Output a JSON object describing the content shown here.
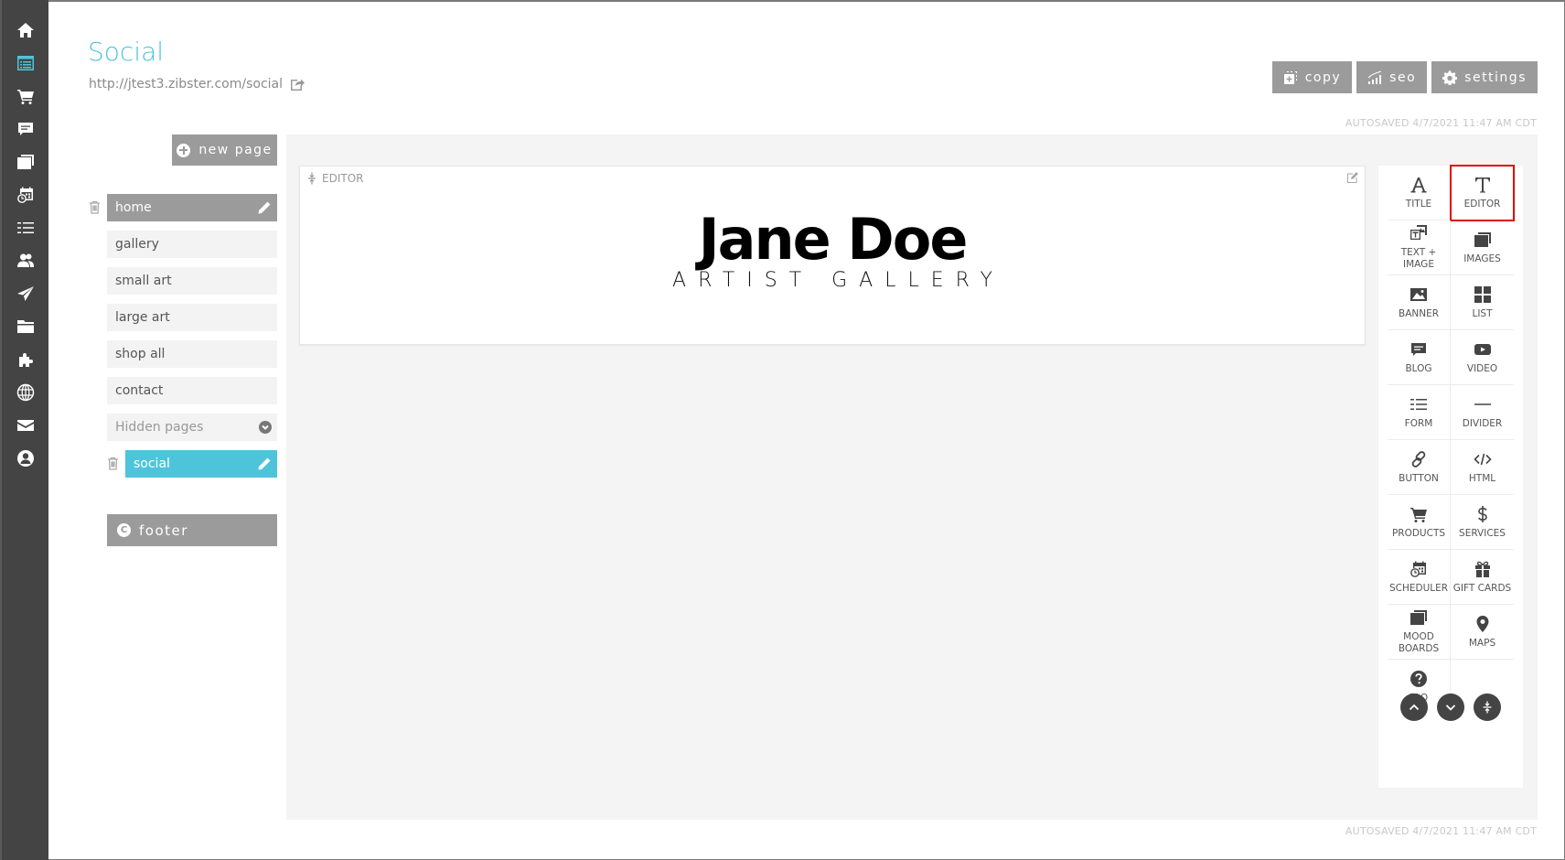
{
  "header": {
    "title": "Social",
    "url": "http://jtest3.zibster.com/social",
    "buttons": [
      {
        "label": "copy",
        "icon": "copy-icon"
      },
      {
        "label": "seo",
        "icon": "signal-bars-icon"
      },
      {
        "label": "settings",
        "icon": "gear-icon"
      }
    ],
    "autosaved_top": "AUTOSAVED 4/7/2021 11:47 AM CDT",
    "autosaved_bottom": "AUTOSAVED 4/7/2021 11:47 AM CDT"
  },
  "sidebar": {
    "items": [
      {
        "name": "home",
        "icon": "home-icon"
      },
      {
        "name": "pages",
        "icon": "pages-icon",
        "active": true
      },
      {
        "name": "store",
        "icon": "cart-icon"
      },
      {
        "name": "blog",
        "icon": "chat-icon"
      },
      {
        "name": "gallery",
        "icon": "images-icon"
      },
      {
        "name": "scheduler",
        "icon": "calendar-clock-icon"
      },
      {
        "name": "forms",
        "icon": "list-icon"
      },
      {
        "name": "contacts",
        "icon": "users-icon"
      },
      {
        "name": "campaigns",
        "icon": "paper-plane-icon"
      },
      {
        "name": "files",
        "icon": "folder-icon"
      },
      {
        "name": "apps",
        "icon": "puzzle-icon"
      },
      {
        "name": "domains",
        "icon": "globe-icon"
      },
      {
        "name": "email",
        "icon": "envelope-icon"
      },
      {
        "name": "account",
        "icon": "user-circle-icon"
      }
    ]
  },
  "pages": {
    "new_page_label": "new page",
    "list": [
      {
        "label": "home",
        "state": "selected"
      },
      {
        "label": "gallery"
      },
      {
        "label": "small art"
      },
      {
        "label": "large art"
      },
      {
        "label": "shop all"
      },
      {
        "label": "contact"
      }
    ],
    "hidden_toggle": "Hidden pages",
    "hidden_list": [
      {
        "label": "social",
        "state": "active"
      }
    ],
    "footer_label": "footer"
  },
  "editor": {
    "block_label": "EDITOR",
    "logo_name": "Jane Doe",
    "logo_subtitle": "ARTIST GALLERY"
  },
  "widgets": {
    "items": [
      {
        "label": "TITLE",
        "icon": "title-a-icon"
      },
      {
        "label": "EDITOR",
        "icon": "text-t-icon",
        "highlighted": true
      },
      {
        "label": "TEXT + IMAGE",
        "icon": "text-image-icon"
      },
      {
        "label": "IMAGES",
        "icon": "images-icon"
      },
      {
        "label": "BANNER",
        "icon": "banner-image-icon"
      },
      {
        "label": "LIST",
        "icon": "grid-icon"
      },
      {
        "label": "BLOG",
        "icon": "chat-icon"
      },
      {
        "label": "VIDEO",
        "icon": "video-play-icon"
      },
      {
        "label": "FORM",
        "icon": "form-list-icon"
      },
      {
        "label": "DIVIDER",
        "icon": "divider-icon"
      },
      {
        "label": "BUTTON",
        "icon": "link-icon"
      },
      {
        "label": "HTML",
        "icon": "code-icon"
      },
      {
        "label": "PRODUCTS",
        "icon": "cart-icon"
      },
      {
        "label": "SERVICES",
        "icon": "dollar-icon"
      },
      {
        "label": "SCHEDULER",
        "icon": "calendar-clock-icon"
      },
      {
        "label": "GIFT CARDS",
        "icon": "gift-icon"
      },
      {
        "label": "MOOD BOARDS",
        "icon": "images-icon"
      },
      {
        "label": "MAPS",
        "icon": "map-pin-icon"
      },
      {
        "label": "FAQ",
        "icon": "question-circle-icon"
      }
    ],
    "nav": [
      {
        "name": "move-up",
        "icon": "chevron-up-icon"
      },
      {
        "name": "move-down",
        "icon": "chevron-down-icon"
      },
      {
        "name": "collapse",
        "icon": "collapse-icon"
      }
    ]
  },
  "colors": {
    "accent": "#4ec4da",
    "sidebar_bg": "#444444",
    "button_gray": "#9b9b9b",
    "highlight_red": "#e30000"
  }
}
